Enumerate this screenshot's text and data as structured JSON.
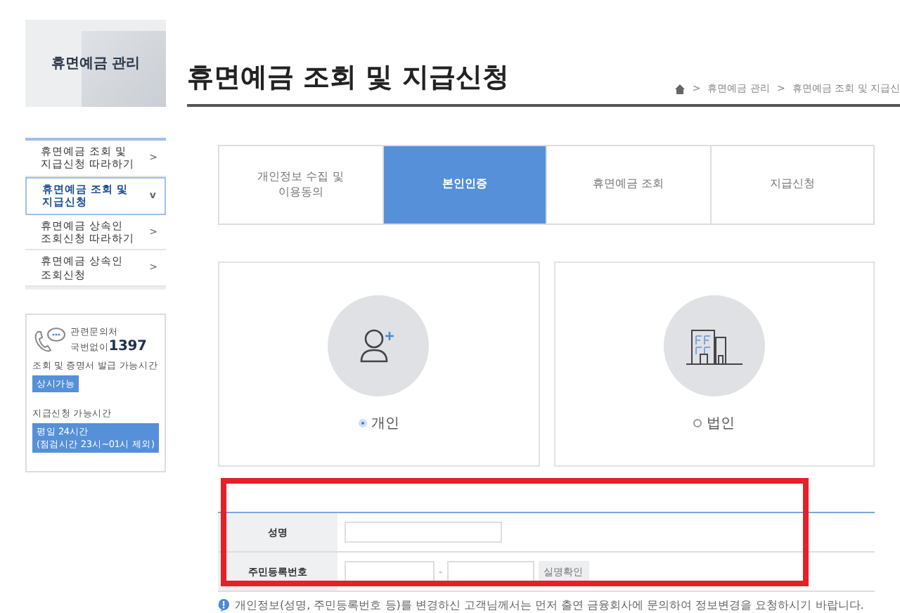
{
  "sidebar": {
    "title": "휴면예금 관리",
    "items": [
      {
        "label": "휴면예금 조회 및\n지급신청 따라하기",
        "selected": false,
        "arrow": ">"
      },
      {
        "label": "휴면예금 조회 및\n지급신청",
        "selected": true,
        "arrow": "v"
      },
      {
        "label": "휴면예금 상속인\n조회신청 따라하기",
        "selected": false,
        "arrow": ">"
      },
      {
        "label": "휴면예금 상속인\n조회신청",
        "selected": false,
        "arrow": ">"
      }
    ],
    "contact": {
      "label": "관련문의처",
      "prefix": "국번없이",
      "number": "1397",
      "hours": [
        {
          "label": "조회 및 증명서 발급 가능시간",
          "badge": "상시가능"
        },
        {
          "label": "지급신청 가능시간",
          "badge": "평일 24시간\n(점검시간 23시~01시 제외)"
        }
      ]
    }
  },
  "main": {
    "title": "휴면예금 조회 및 지급신청",
    "breadcrumb_separator": ">",
    "breadcrumb": [
      "휴면예금 관리",
      "휴면예금 조회 및 지급신"
    ],
    "steps": [
      {
        "label": "개인정보 수집 및\n이용동의",
        "selected": false
      },
      {
        "label": "본인인증",
        "selected": true
      },
      {
        "label": "휴면예금 조회",
        "selected": false
      },
      {
        "label": "지급신청",
        "selected": false
      }
    ],
    "types": [
      {
        "kind": "person",
        "label": "개인",
        "selected": true
      },
      {
        "kind": "company",
        "label": "법인",
        "selected": false
      }
    ],
    "form": {
      "rows": [
        {
          "label": "성명",
          "kind": "text"
        },
        {
          "label": "주민등록번호",
          "kind": "rrn",
          "separator": "-",
          "button": "실명확인"
        }
      ]
    },
    "notice": "개인정보(성명, 주민등록번호 등)를 변경하신 고객님께서는 먼저 출연 금융회사에 문의하여 정보변경을 요청하시기 바랍니다."
  }
}
